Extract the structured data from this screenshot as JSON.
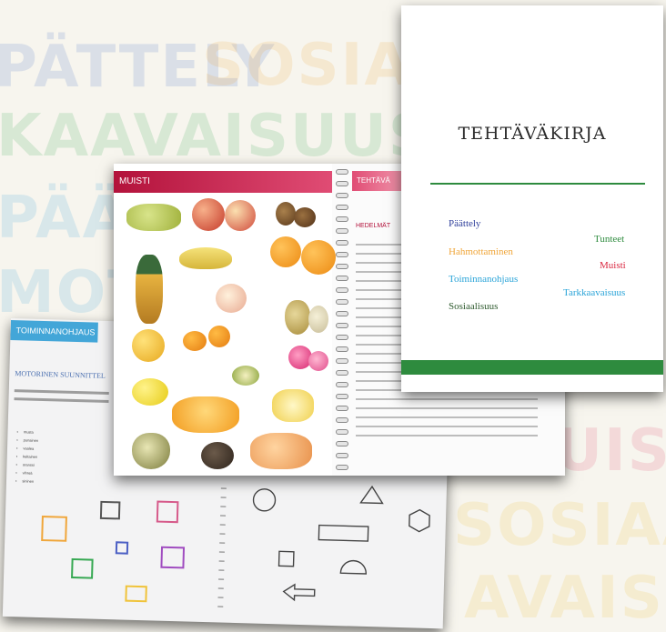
{
  "background_words": [
    {
      "text": "PÄTTELY",
      "color": "#4b74c4"
    },
    {
      "text": "SOSIAAL",
      "color": "#f0a63a"
    },
    {
      "text": "KAAVAISUUSTO",
      "color": "#36a852"
    },
    {
      "text": "PÄÄ",
      "color": "#3ba4d8"
    },
    {
      "text": "MOT",
      "color": "#3ba4d8"
    },
    {
      "text": "UIST",
      "color": "#e04c74"
    },
    {
      "text": "SOSIAAL",
      "color": "#f0c33a"
    },
    {
      "text": "AVAISUU",
      "color": "#f0c33a"
    }
  ],
  "cover": {
    "title": "TEHTÄVÄKIRJA",
    "categories": [
      {
        "label": "Päättely",
        "color": "#2f3f9b"
      },
      {
        "label": "Tunteet",
        "color": "#2e8b3e"
      },
      {
        "label": "Hahmottaminen",
        "color": "#f0a63a"
      },
      {
        "label": "Muisti",
        "color": "#d9263f"
      },
      {
        "label": "Toiminnanohjaus",
        "color": "#2aa4d8"
      },
      {
        "label": "Tarkkaavaisuus",
        "color": "#2aa4d8"
      },
      {
        "label": "Sosiaalisuus",
        "color": "#2e5a2e"
      }
    ],
    "accent_color": "#2e8b3e"
  },
  "memory_book": {
    "tab_label": "MUISTI",
    "right_tab_label": "TEHTÄVÄ",
    "right_heading": "HEDELMÄT",
    "tab_color": "#b3123b"
  },
  "planning_book": {
    "tab_label": "TOIMINNANOHJAUS",
    "heading": "MOTORINEN SUUNNITTEL",
    "list_items": [
      "musta",
      "punainen",
      "vaalea",
      "keltainen",
      "oranssi",
      "vihreä",
      "sininen"
    ],
    "tab_color": "#43a6d8"
  }
}
